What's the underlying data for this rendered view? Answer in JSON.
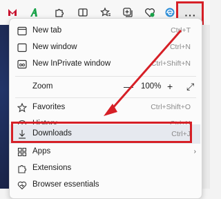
{
  "colors": {
    "annotation_red": "#d61f26",
    "brand_red": "#c8102e",
    "brand_green": "#1aa34a",
    "highlight_row": "#e6e9ef"
  },
  "toolbar": {
    "icons": [
      "mcafee-icon",
      "adguard-icon",
      "extensions-icon",
      "split-screen-icon",
      "favorites-icon",
      "collections-icon",
      "health-icon",
      "edge-icon"
    ],
    "more_label": "···"
  },
  "menu": {
    "new_tab": {
      "label": "New tab",
      "shortcut": "Ctrl+T"
    },
    "new_window": {
      "label": "New window",
      "shortcut": "Ctrl+N"
    },
    "new_inprivate": {
      "label": "New InPrivate window",
      "shortcut": "Ctrl+Shift+N"
    },
    "zoom": {
      "label": "Zoom",
      "minus": "—",
      "value": "100%",
      "plus": "+",
      "fullscreen": "⤢"
    },
    "favorites": {
      "label": "Favorites",
      "shortcut": "Ctrl+Shift+O"
    },
    "history": {
      "label": "History",
      "shortcut": "Ctrl+H"
    },
    "downloads": {
      "label": "Downloads",
      "shortcut": "Ctrl+J"
    },
    "apps": {
      "label": "Apps"
    },
    "extensions": {
      "label": "Extensions"
    },
    "browser_essentials": {
      "label": "Browser essentials"
    }
  }
}
